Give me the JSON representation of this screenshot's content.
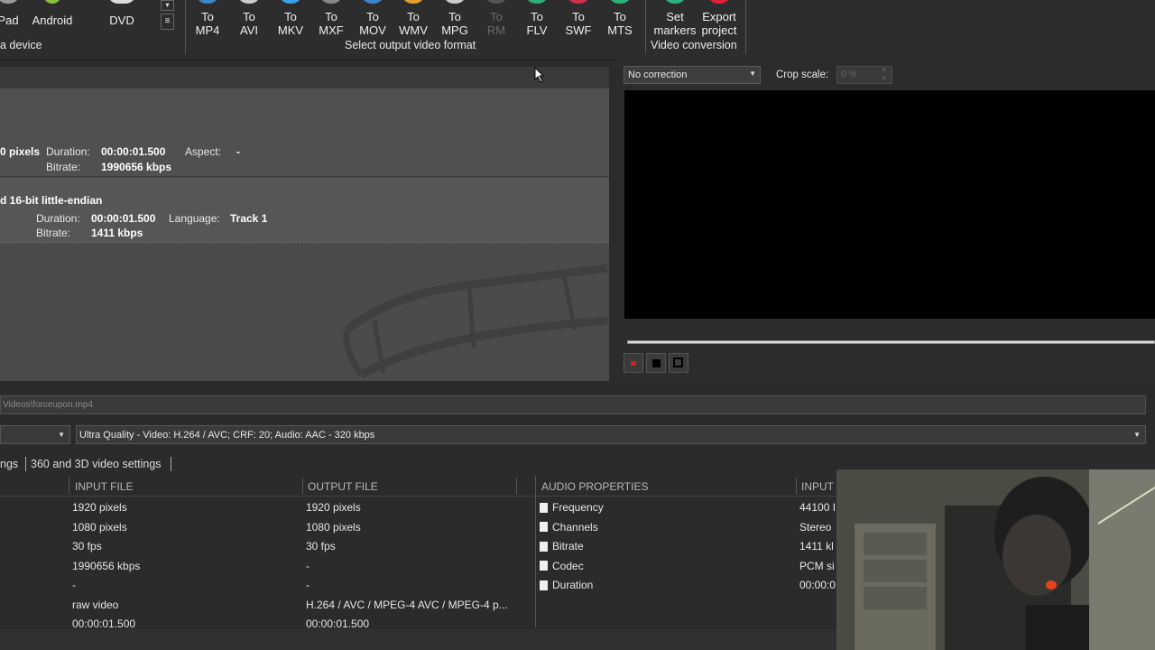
{
  "ribbon": {
    "devices": [
      {
        "label": "Pad",
        "icon": "ipad-icon"
      },
      {
        "label": "Android",
        "icon": "android-icon"
      },
      {
        "label": "DVD",
        "icon": "dvd-icon"
      }
    ],
    "devices_group_label": "a device",
    "formats": [
      {
        "line1": "To",
        "line2": "MP4",
        "icon": "mp4-icon",
        "color": "#3b86c9"
      },
      {
        "line1": "To",
        "line2": "AVI",
        "icon": "avi-icon",
        "color": "#cccccc"
      },
      {
        "line1": "To",
        "line2": "MKV",
        "icon": "mkv-icon",
        "color": "#3aa0e8"
      },
      {
        "line1": "To",
        "line2": "MXF",
        "icon": "mxf-icon",
        "color": "#888888"
      },
      {
        "line1": "To",
        "line2": "MOV",
        "icon": "mov-icon",
        "color": "#3b86c9"
      },
      {
        "line1": "To",
        "line2": "WMV",
        "icon": "wmv-icon",
        "color": "#e0a030"
      },
      {
        "line1": "To",
        "line2": "MPG",
        "icon": "mpg-icon",
        "color": "#cccccc"
      },
      {
        "line1": "To",
        "line2": "RM",
        "icon": "rm-icon",
        "color": "#555555"
      },
      {
        "line1": "To",
        "line2": "FLV",
        "icon": "flv-icon",
        "color": "#2fb07a"
      },
      {
        "line1": "To",
        "line2": "SWF",
        "icon": "swf-icon",
        "color": "#d0304a"
      },
      {
        "line1": "To",
        "line2": "MTS",
        "icon": "mts-icon",
        "color": "#2fb07a"
      }
    ],
    "formats_group_label": "Select output video format",
    "conversion": [
      {
        "line1": "Set",
        "line2": "markers",
        "icon": "markers-icon",
        "color": "#2fb07a"
      },
      {
        "line1": "Export",
        "line2": "project",
        "icon": "export-icon",
        "color": "#e0203a"
      }
    ],
    "conversion_group_label": "Video conversion"
  },
  "source": {
    "video": {
      "size_fragment": "0 pixels",
      "duration_label": "Duration:",
      "duration": "00:00:01.500",
      "aspect_label": "Aspect:",
      "aspect": "-",
      "bitrate_label": "Bitrate:",
      "bitrate": "1990656 kbps"
    },
    "audio": {
      "format_fragment": "d 16-bit little-endian",
      "duration_label": "Duration:",
      "duration": "00:00:01.500",
      "language_label": "Language:",
      "language": "Track 1",
      "bitrate_label": "Bitrate:",
      "bitrate": "1411 kbps"
    }
  },
  "preview": {
    "correction": "No correction",
    "crop_label": "Crop scale:",
    "crop_value": "0 %"
  },
  "output_path": "Videos\\forceupon.mp4",
  "profile": "Ultra Quality - Video: H.264 / AVC; CRF: 20; Audio: AAC - 320 kbps",
  "tabs": [
    "ngs",
    "360 and 3D video settings"
  ],
  "video_table": {
    "headers": [
      "INPUT FILE",
      "OUTPUT FILE"
    ],
    "rows": [
      [
        "1920 pixels",
        "1920 pixels"
      ],
      [
        "1080 pixels",
        "1080 pixels"
      ],
      [
        "30 fps",
        "30 fps"
      ],
      [
        "1990656 kbps",
        "-"
      ],
      [
        "-",
        "-"
      ],
      [
        "raw video",
        "H.264 / AVC / MPEG-4 AVC / MPEG-4 p..."
      ],
      [
        "00:00:01.500",
        "00:00:01.500"
      ]
    ]
  },
  "audio_table": {
    "headers": [
      "AUDIO PROPERTIES",
      "INPUT"
    ],
    "rows": [
      [
        "Frequency",
        "44100 I"
      ],
      [
        "Channels",
        "Stereo"
      ],
      [
        "Bitrate",
        "1411 kl"
      ],
      [
        "Codec",
        "PCM si"
      ],
      [
        "Duration",
        "00:00:0"
      ]
    ]
  }
}
